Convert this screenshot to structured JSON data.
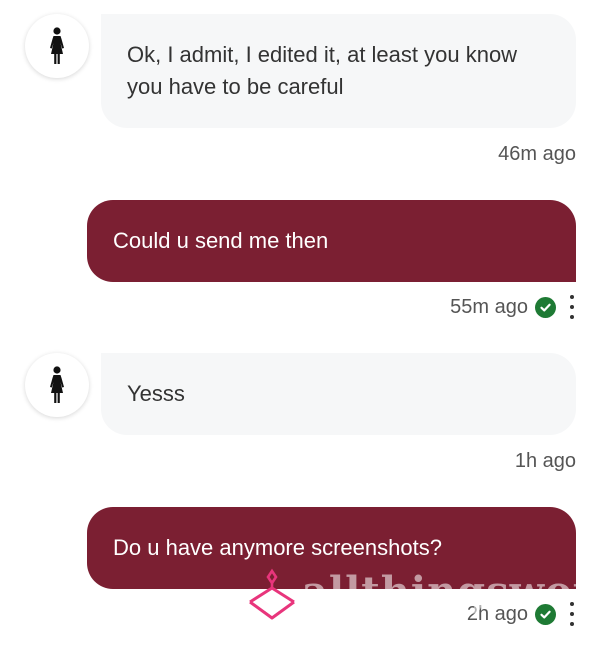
{
  "messages": [
    {
      "direction": "incoming",
      "text": "Ok, I admit, I edited it, at least you know you have to be careful",
      "time": "46m ago",
      "avatar_icon": "female-figure-icon"
    },
    {
      "direction": "outgoing",
      "text": "Could u send me then",
      "time": "55m ago",
      "status_icon": "read-check-icon"
    },
    {
      "direction": "incoming",
      "text": "Yesss",
      "time": "1h ago",
      "avatar_icon": "female-figure-icon"
    },
    {
      "direction": "outgoing",
      "text": "Do u have anymore screenshots?",
      "time": "2h ago",
      "status_icon": "read-check-icon"
    }
  ],
  "watermark": {
    "text": "allthingsworn",
    "icon": "hanger-logo-icon"
  },
  "colors": {
    "outgoing_bubble": "#7b1f32",
    "incoming_bubble": "#f6f7f8",
    "check": "#1e7a34",
    "watermark_logo": "#e8357c"
  }
}
